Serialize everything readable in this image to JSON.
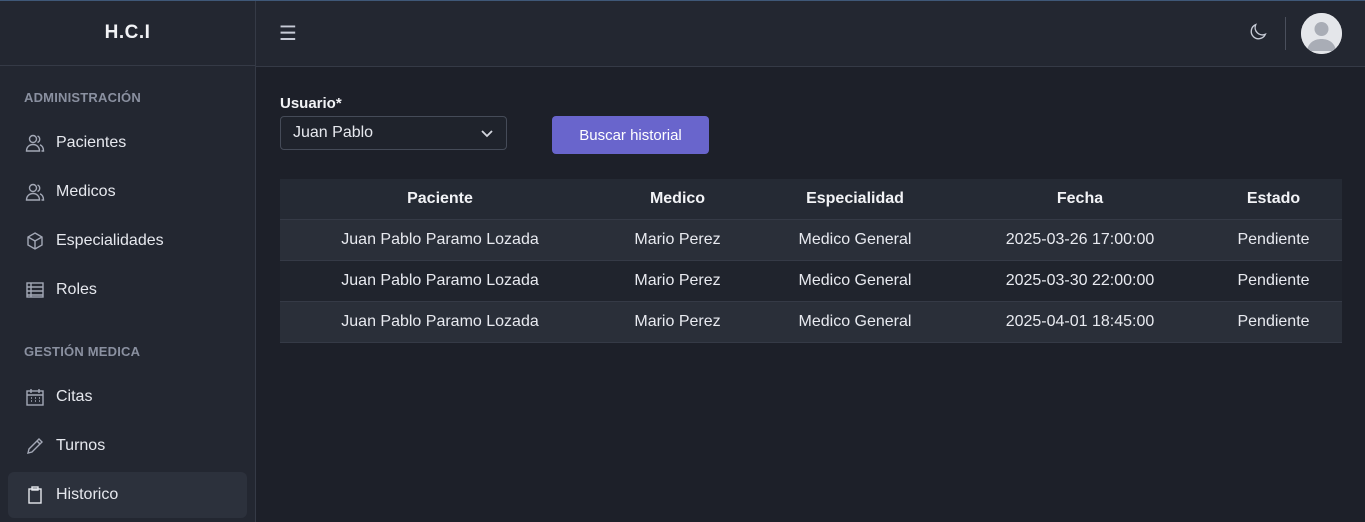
{
  "brand": "H.C.I",
  "sidebar": {
    "sections": [
      {
        "title": "ADMINISTRACIÓN",
        "items": [
          {
            "label": "Pacientes",
            "icon": "users-icon"
          },
          {
            "label": "Medicos",
            "icon": "users-icon"
          },
          {
            "label": "Especialidades",
            "icon": "cube-icon"
          },
          {
            "label": "Roles",
            "icon": "list-icon"
          }
        ]
      },
      {
        "title": "GESTIÓN MEDICA",
        "items": [
          {
            "label": "Citas",
            "icon": "calendar-icon"
          },
          {
            "label": "Turnos",
            "icon": "pencil-icon"
          },
          {
            "label": "Historico",
            "icon": "clipboard-icon",
            "active": true
          }
        ]
      }
    ]
  },
  "topbar": {
    "menu_icon": "hamburger-icon",
    "theme_icon": "moon-icon",
    "avatar_icon": "user-avatar-icon"
  },
  "form": {
    "user_label": "Usuario*",
    "user_value": "Juan Pablo",
    "search_button": "Buscar historial"
  },
  "table": {
    "headers": [
      "Paciente",
      "Medico",
      "Especialidad",
      "Fecha",
      "Estado"
    ],
    "rows": [
      [
        "Juan Pablo Paramo Lozada",
        "Mario Perez",
        "Medico General",
        "2025-03-26 17:00:00",
        "Pendiente"
      ],
      [
        "Juan Pablo Paramo Lozada",
        "Mario Perez",
        "Medico General",
        "2025-03-30 22:00:00",
        "Pendiente"
      ],
      [
        "Juan Pablo Paramo Lozada",
        "Mario Perez",
        "Medico General",
        "2025-04-01 18:45:00",
        "Pendiente"
      ]
    ]
  },
  "colors": {
    "background": "#1d2029",
    "panel": "#232731",
    "accent": "#6965cc"
  }
}
